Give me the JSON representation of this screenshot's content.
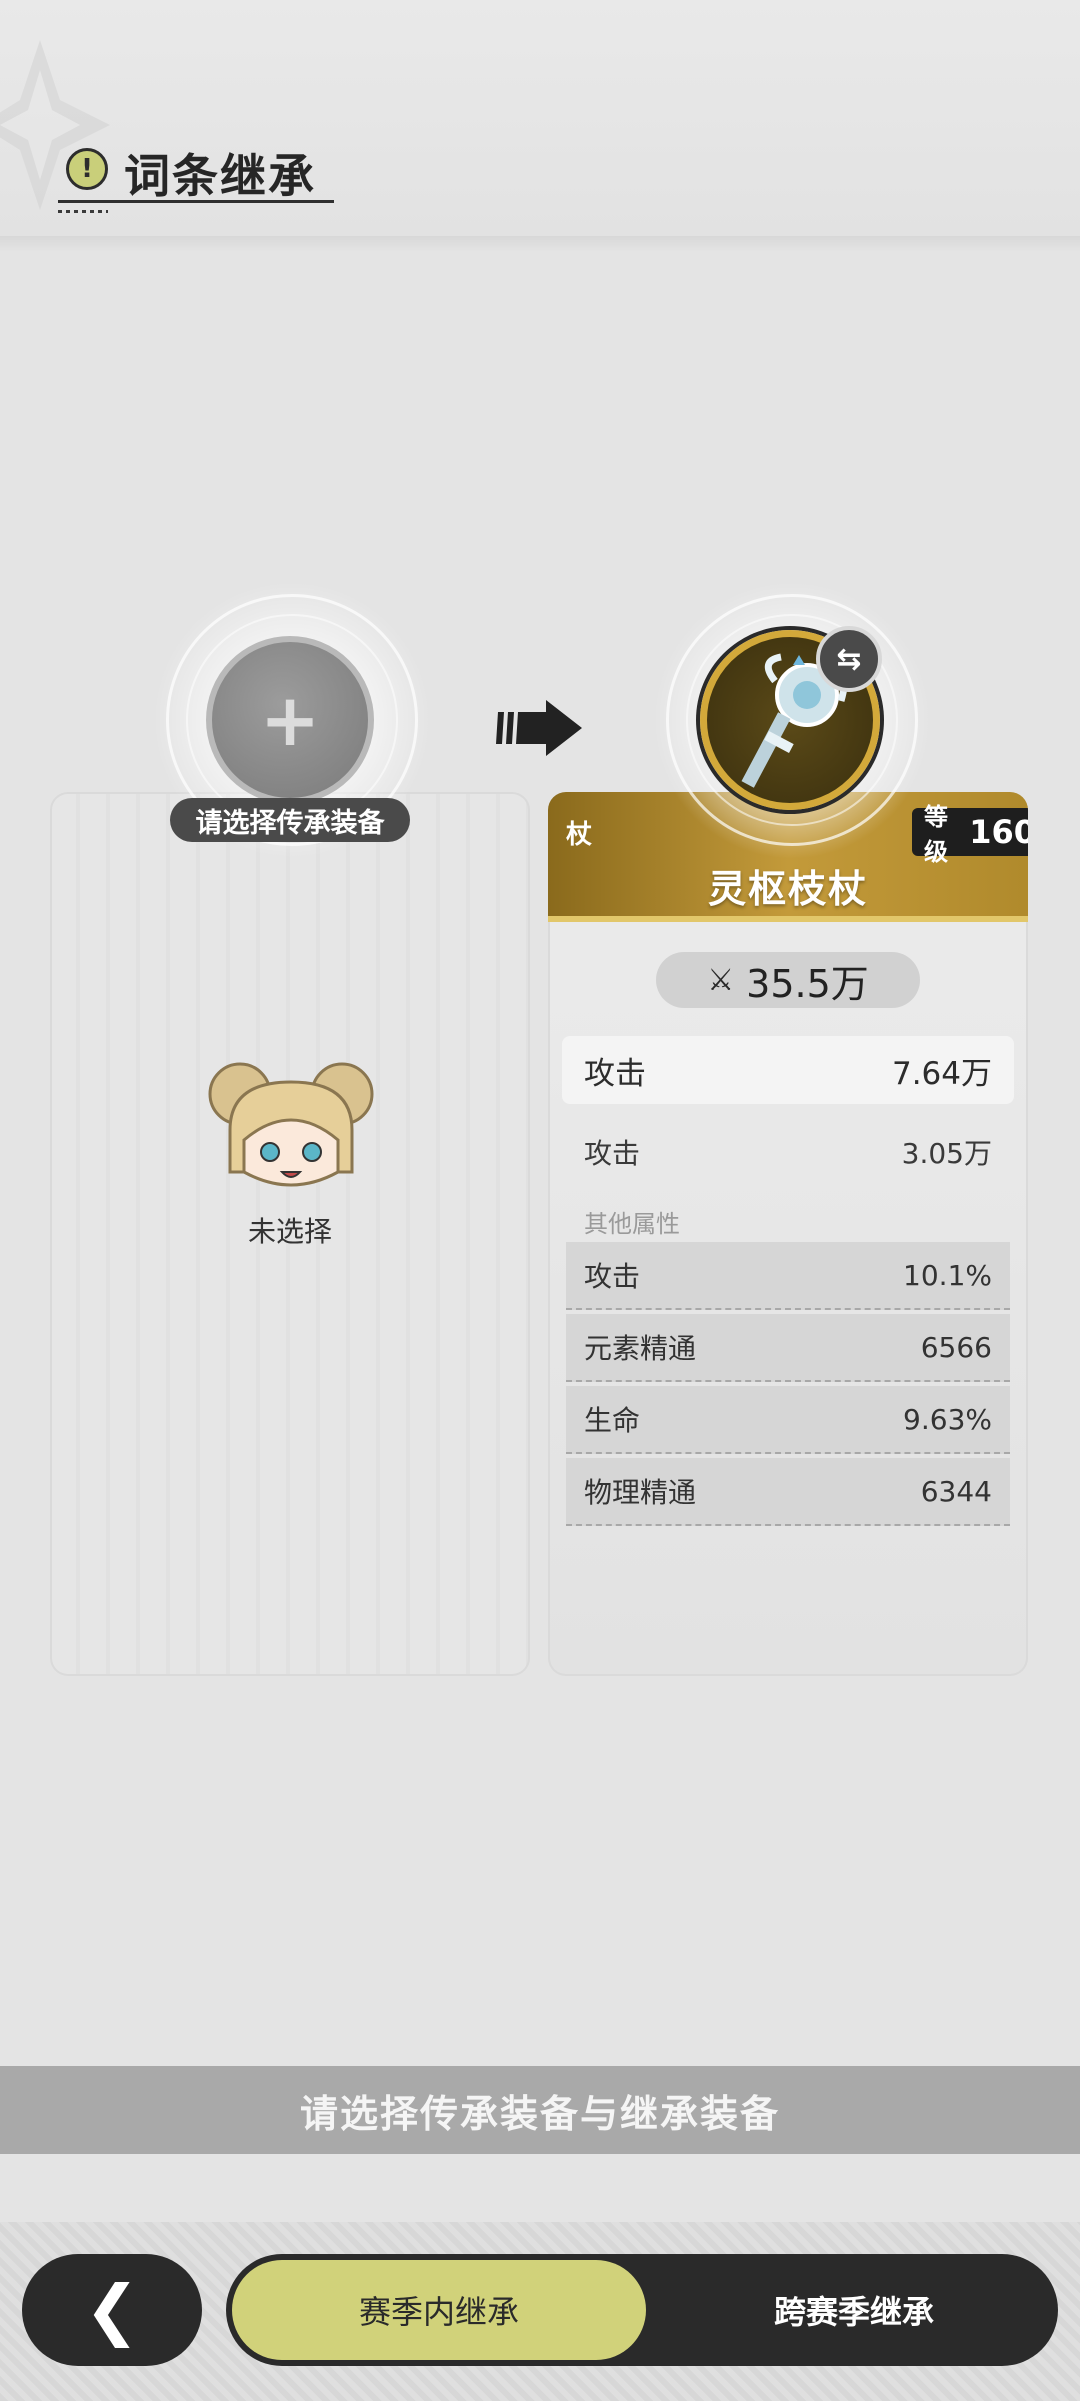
{
  "header": {
    "title": "词条继承"
  },
  "source_slot": {
    "caption": "请选择传承装备"
  },
  "left_panel": {
    "empty_label": "未选择"
  },
  "target": {
    "weapon_type": "杖",
    "level_label": "等级",
    "level": "160",
    "name": "灵枢枝杖",
    "power": "35.5万",
    "main_stat": {
      "label": "攻击",
      "value": "7.64万"
    },
    "sub_stat": {
      "label": "攻击",
      "value": "3.05万"
    },
    "other_title": "其他属性",
    "other_stats": [
      {
        "label": "攻击",
        "value": "10.1%"
      },
      {
        "label": "元素精通",
        "value": "6566"
      },
      {
        "label": "生命",
        "value": "9.63%"
      },
      {
        "label": "物理精通",
        "value": "6344"
      }
    ]
  },
  "banner": "请选择传承装备与继承装备",
  "tabs": [
    {
      "label": "赛季内继承",
      "active": true
    },
    {
      "label": "跨赛季继承",
      "active": false
    }
  ],
  "colors": {
    "accent": "#d1d27a",
    "gold": "#d3a93a",
    "dark": "#2a2a2a"
  },
  "icons": [
    "alert-icon",
    "plus-icon",
    "arrow-right-icon",
    "weapon-staff-icon",
    "swap-icon",
    "power-icon",
    "avatar-icon",
    "back-icon"
  ]
}
